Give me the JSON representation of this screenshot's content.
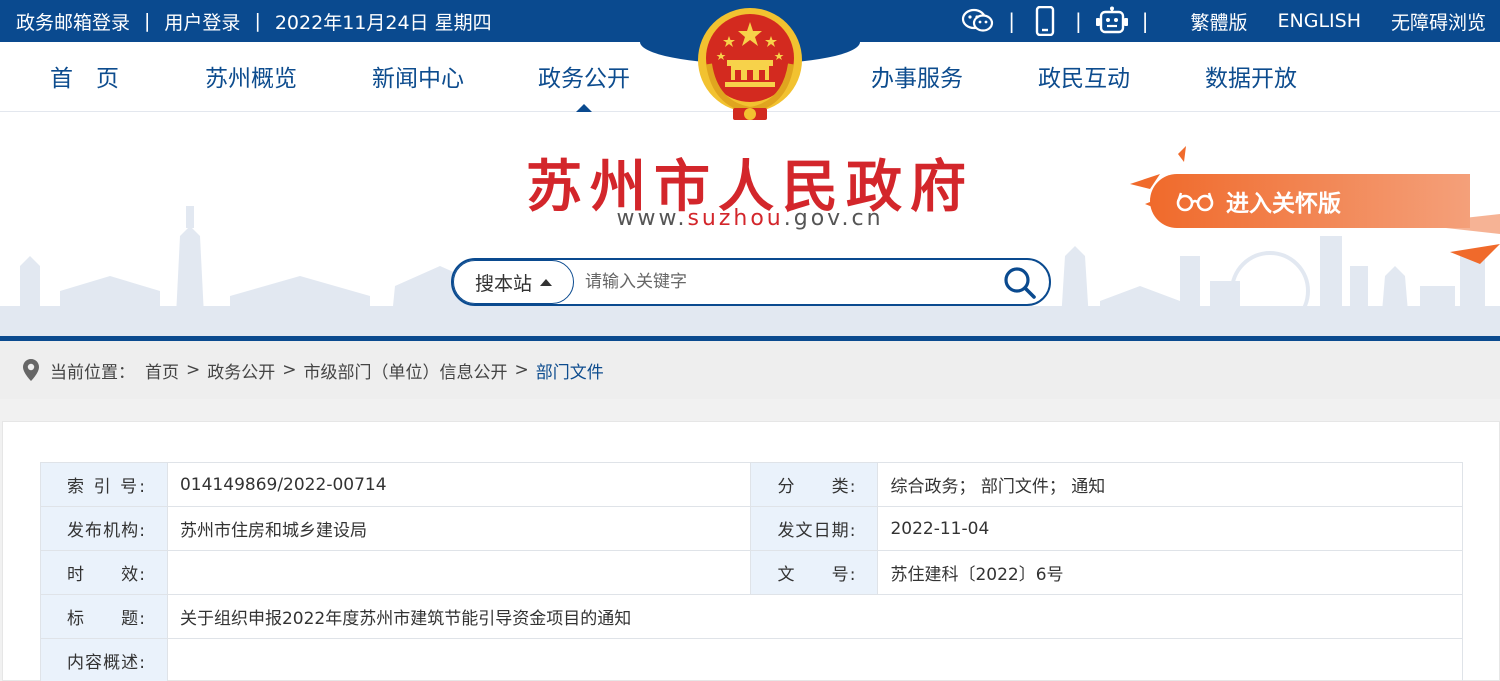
{
  "topbar": {
    "mail_login": "政务邮箱登录",
    "user_login": "用户登录",
    "date": "2022年11月24日 星期四",
    "icons": [
      "wechat-icon",
      "mobile-icon",
      "robot-icon"
    ],
    "traditional": "繁體版",
    "english": "ENGLISH",
    "accessible": "无障碍浏览",
    "separator": "|"
  },
  "nav": {
    "items": [
      "首　页",
      "苏州概览",
      "新闻中心",
      "政务公开",
      "办事服务",
      "政民互动",
      "数据开放"
    ],
    "active": "政务公开"
  },
  "banner": {
    "title": "苏州市人民政府",
    "url_prefix": "www.",
    "url_mid": "suzhou",
    "url_suffix": ".gov.cn",
    "care_label": "进入关怀版"
  },
  "search": {
    "scope": "搜本站",
    "placeholder": "请输入关键字"
  },
  "breadcrumb": {
    "label": "当前位置：",
    "items": [
      "首页",
      "政务公开",
      "市级部门（单位）信息公开",
      "部门文件"
    ],
    "sep": ">"
  },
  "meta": {
    "index_label": "索 引 号:",
    "index_value": "014149869/2022-00714",
    "category_label": "分　　类:",
    "category_value": "综合政务；  部门文件；  通知",
    "publisher_label": "发布机构:",
    "publisher_value": "苏州市住房和城乡建设局",
    "date_label": "发文日期:",
    "date_value": "2022-11-04",
    "validity_label": "时　　效:",
    "validity_value": "",
    "docno_label": "文　　号:",
    "docno_value": "苏住建科〔2022〕6号",
    "title_label": "标　　题:",
    "title_value": "关于组织申报2022年度苏州市建筑节能引导资金项目的通知",
    "summary_label": "内容概述:",
    "summary_value": ""
  },
  "colors": {
    "primary_blue": "#0a4a8f",
    "title_red": "#d3262b",
    "care_orange": "#f06a2b",
    "label_bg": "#eaf2fb"
  }
}
